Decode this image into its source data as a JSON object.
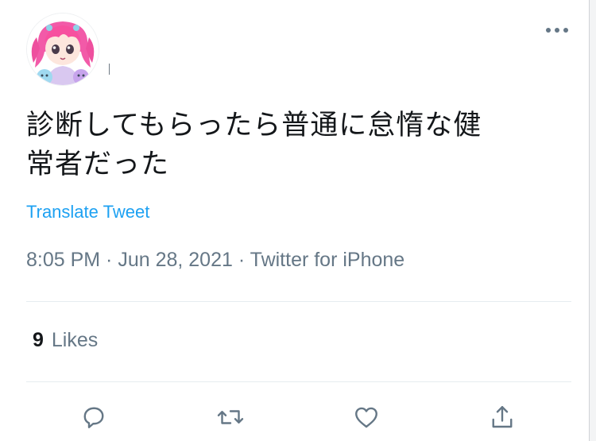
{
  "tweet": {
    "text_line1": "診断してもらったら普通に怠惰な健",
    "text_line2": "常者だった",
    "translate_label": "Translate Tweet",
    "time": "8:05 PM",
    "date": "Jun 28, 2021",
    "source": "Twitter for iPhone",
    "separator": " · "
  },
  "stats": {
    "likes_count": "9",
    "likes_label": "Likes"
  },
  "icons": {
    "more": "more-options-icon",
    "reply": "reply-icon",
    "retweet": "retweet-icon",
    "like": "heart-icon",
    "share": "share-icon"
  },
  "colors": {
    "link": "#1da1f2",
    "secondary_text": "#657786",
    "primary_text": "#14171a",
    "icon": "#657786"
  }
}
